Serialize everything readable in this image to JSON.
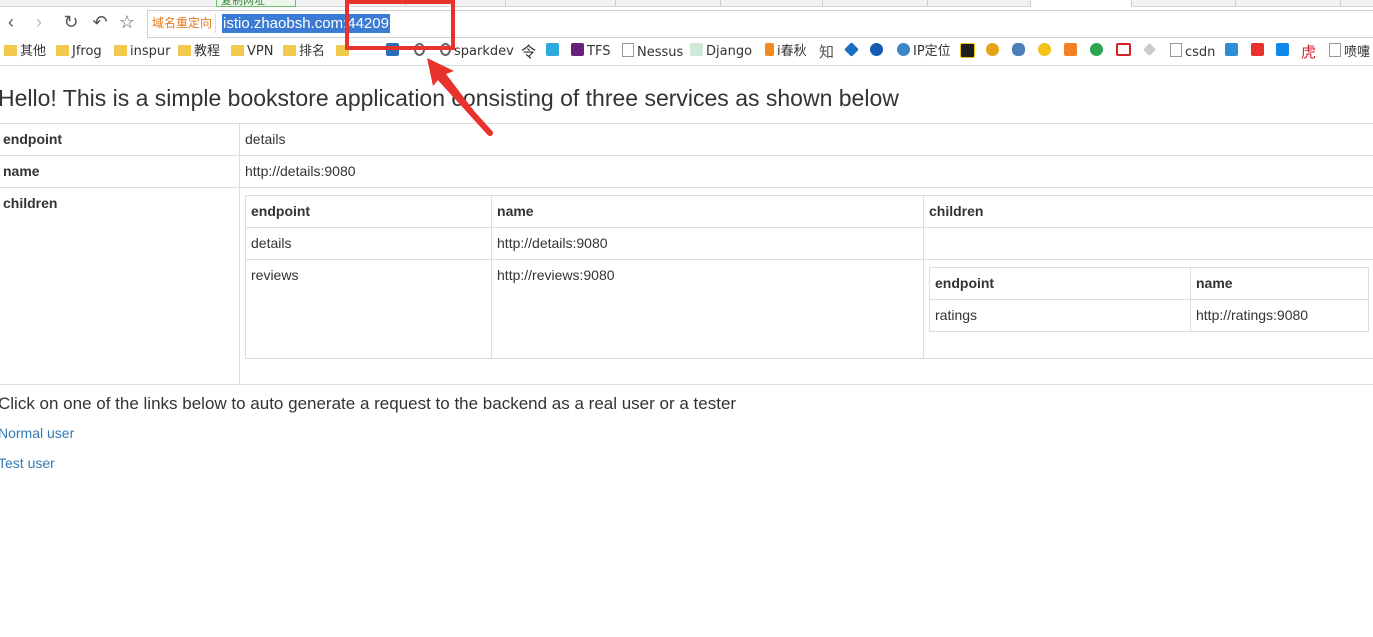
{
  "browser": {
    "tab_label": "复制网址",
    "redirect_label": "域名重定向",
    "url": "istio.zhaobsh.com:44209"
  },
  "bookmarks": [
    {
      "label": "其他",
      "icon": "folder-icon"
    },
    {
      "label": "Jfrog",
      "icon": "folder-icon"
    },
    {
      "label": "inspur",
      "icon": "folder-icon"
    },
    {
      "label": "教程",
      "icon": "folder-icon"
    },
    {
      "label": "VPN",
      "icon": "folder-icon"
    },
    {
      "label": "排名",
      "icon": "folder-icon"
    },
    {
      "label": "sparkdev",
      "icon": "page-icon"
    },
    {
      "label": "TFS",
      "icon": "vs-icon"
    },
    {
      "label": "Nessus",
      "icon": "page-icon"
    },
    {
      "label": "Django",
      "icon": "django-icon"
    },
    {
      "label": "i春秋",
      "icon": "ichunqiu-icon"
    },
    {
      "label": "IP定位",
      "icon": "ip-icon"
    },
    {
      "label": "csdn",
      "icon": "page-icon"
    },
    {
      "label": "喷嚏",
      "icon": "page-icon"
    }
  ],
  "page": {
    "heading": "Hello! This is a simple bookstore application consisting of three services as shown below",
    "rows": {
      "endpoint": {
        "key": "endpoint",
        "value": "details"
      },
      "name": {
        "key": "name",
        "value": "http://details:9080"
      },
      "children": {
        "key": "children"
      }
    },
    "children_headers": {
      "endpoint": "endpoint",
      "name": "name",
      "children": "children"
    },
    "children_rows": [
      {
        "endpoint": "details",
        "name": "http://details:9080"
      },
      {
        "endpoint": "reviews",
        "name": "http://reviews:9080"
      }
    ],
    "grandchildren_headers": {
      "endpoint": "endpoint",
      "name": "name"
    },
    "grandchildren_rows": [
      {
        "endpoint": "ratings",
        "name": "http://ratings:9080"
      }
    ],
    "instruction": "Click on one of the links below to auto generate a request to the backend as a real user or a tester",
    "links": {
      "normal": "Normal user",
      "test": "Test user"
    }
  },
  "colors": {
    "annotation": "#e8322b",
    "link": "#337ab7",
    "selection": "#3b7bd4"
  }
}
